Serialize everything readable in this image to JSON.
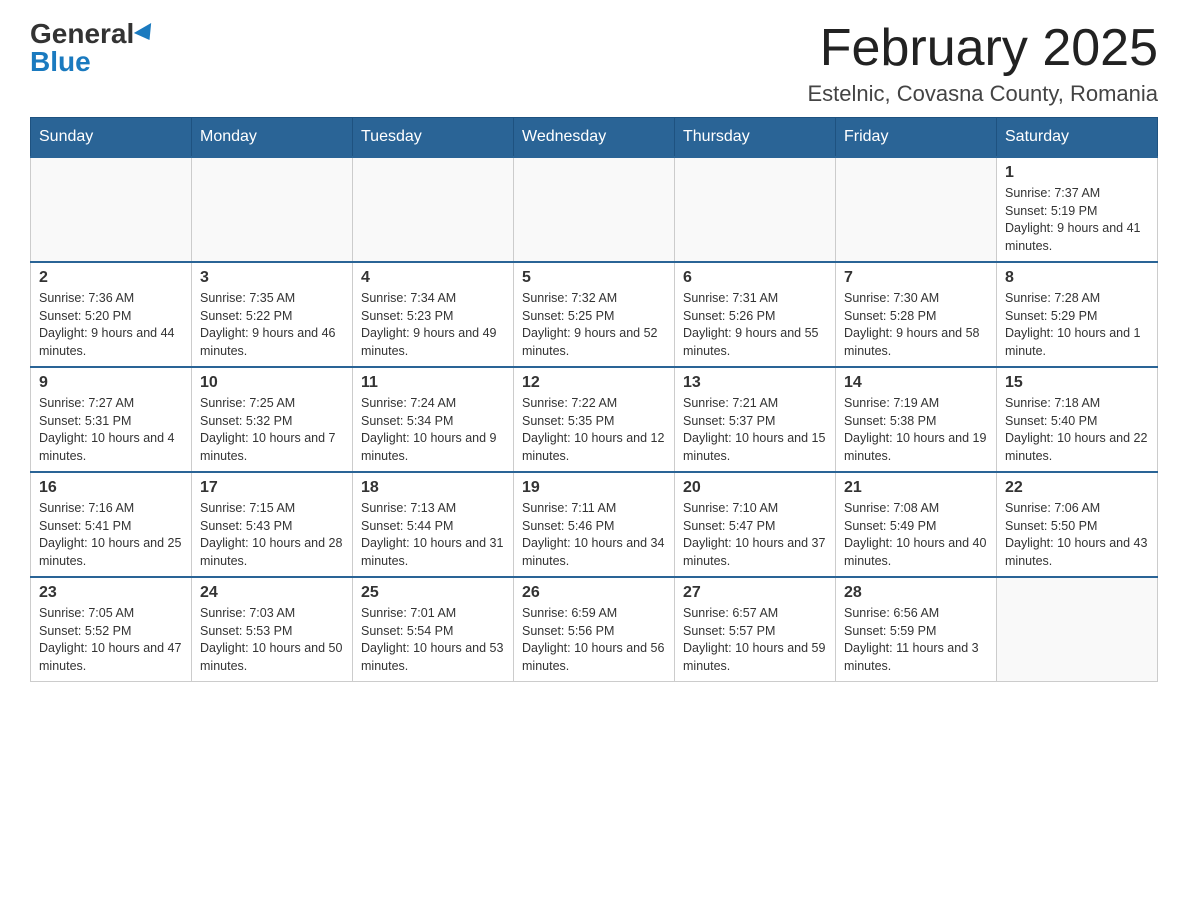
{
  "header": {
    "logo_general": "General",
    "logo_blue": "Blue",
    "month_title": "February 2025",
    "location": "Estelnic, Covasna County, Romania"
  },
  "weekdays": [
    "Sunday",
    "Monday",
    "Tuesday",
    "Wednesday",
    "Thursday",
    "Friday",
    "Saturday"
  ],
  "weeks": [
    [
      {
        "day": "",
        "info": ""
      },
      {
        "day": "",
        "info": ""
      },
      {
        "day": "",
        "info": ""
      },
      {
        "day": "",
        "info": ""
      },
      {
        "day": "",
        "info": ""
      },
      {
        "day": "",
        "info": ""
      },
      {
        "day": "1",
        "info": "Sunrise: 7:37 AM\nSunset: 5:19 PM\nDaylight: 9 hours and 41 minutes."
      }
    ],
    [
      {
        "day": "2",
        "info": "Sunrise: 7:36 AM\nSunset: 5:20 PM\nDaylight: 9 hours and 44 minutes."
      },
      {
        "day": "3",
        "info": "Sunrise: 7:35 AM\nSunset: 5:22 PM\nDaylight: 9 hours and 46 minutes."
      },
      {
        "day": "4",
        "info": "Sunrise: 7:34 AM\nSunset: 5:23 PM\nDaylight: 9 hours and 49 minutes."
      },
      {
        "day": "5",
        "info": "Sunrise: 7:32 AM\nSunset: 5:25 PM\nDaylight: 9 hours and 52 minutes."
      },
      {
        "day": "6",
        "info": "Sunrise: 7:31 AM\nSunset: 5:26 PM\nDaylight: 9 hours and 55 minutes."
      },
      {
        "day": "7",
        "info": "Sunrise: 7:30 AM\nSunset: 5:28 PM\nDaylight: 9 hours and 58 minutes."
      },
      {
        "day": "8",
        "info": "Sunrise: 7:28 AM\nSunset: 5:29 PM\nDaylight: 10 hours and 1 minute."
      }
    ],
    [
      {
        "day": "9",
        "info": "Sunrise: 7:27 AM\nSunset: 5:31 PM\nDaylight: 10 hours and 4 minutes."
      },
      {
        "day": "10",
        "info": "Sunrise: 7:25 AM\nSunset: 5:32 PM\nDaylight: 10 hours and 7 minutes."
      },
      {
        "day": "11",
        "info": "Sunrise: 7:24 AM\nSunset: 5:34 PM\nDaylight: 10 hours and 9 minutes."
      },
      {
        "day": "12",
        "info": "Sunrise: 7:22 AM\nSunset: 5:35 PM\nDaylight: 10 hours and 12 minutes."
      },
      {
        "day": "13",
        "info": "Sunrise: 7:21 AM\nSunset: 5:37 PM\nDaylight: 10 hours and 15 minutes."
      },
      {
        "day": "14",
        "info": "Sunrise: 7:19 AM\nSunset: 5:38 PM\nDaylight: 10 hours and 19 minutes."
      },
      {
        "day": "15",
        "info": "Sunrise: 7:18 AM\nSunset: 5:40 PM\nDaylight: 10 hours and 22 minutes."
      }
    ],
    [
      {
        "day": "16",
        "info": "Sunrise: 7:16 AM\nSunset: 5:41 PM\nDaylight: 10 hours and 25 minutes."
      },
      {
        "day": "17",
        "info": "Sunrise: 7:15 AM\nSunset: 5:43 PM\nDaylight: 10 hours and 28 minutes."
      },
      {
        "day": "18",
        "info": "Sunrise: 7:13 AM\nSunset: 5:44 PM\nDaylight: 10 hours and 31 minutes."
      },
      {
        "day": "19",
        "info": "Sunrise: 7:11 AM\nSunset: 5:46 PM\nDaylight: 10 hours and 34 minutes."
      },
      {
        "day": "20",
        "info": "Sunrise: 7:10 AM\nSunset: 5:47 PM\nDaylight: 10 hours and 37 minutes."
      },
      {
        "day": "21",
        "info": "Sunrise: 7:08 AM\nSunset: 5:49 PM\nDaylight: 10 hours and 40 minutes."
      },
      {
        "day": "22",
        "info": "Sunrise: 7:06 AM\nSunset: 5:50 PM\nDaylight: 10 hours and 43 minutes."
      }
    ],
    [
      {
        "day": "23",
        "info": "Sunrise: 7:05 AM\nSunset: 5:52 PM\nDaylight: 10 hours and 47 minutes."
      },
      {
        "day": "24",
        "info": "Sunrise: 7:03 AM\nSunset: 5:53 PM\nDaylight: 10 hours and 50 minutes."
      },
      {
        "day": "25",
        "info": "Sunrise: 7:01 AM\nSunset: 5:54 PM\nDaylight: 10 hours and 53 minutes."
      },
      {
        "day": "26",
        "info": "Sunrise: 6:59 AM\nSunset: 5:56 PM\nDaylight: 10 hours and 56 minutes."
      },
      {
        "day": "27",
        "info": "Sunrise: 6:57 AM\nSunset: 5:57 PM\nDaylight: 10 hours and 59 minutes."
      },
      {
        "day": "28",
        "info": "Sunrise: 6:56 AM\nSunset: 5:59 PM\nDaylight: 11 hours and 3 minutes."
      },
      {
        "day": "",
        "info": ""
      }
    ]
  ]
}
